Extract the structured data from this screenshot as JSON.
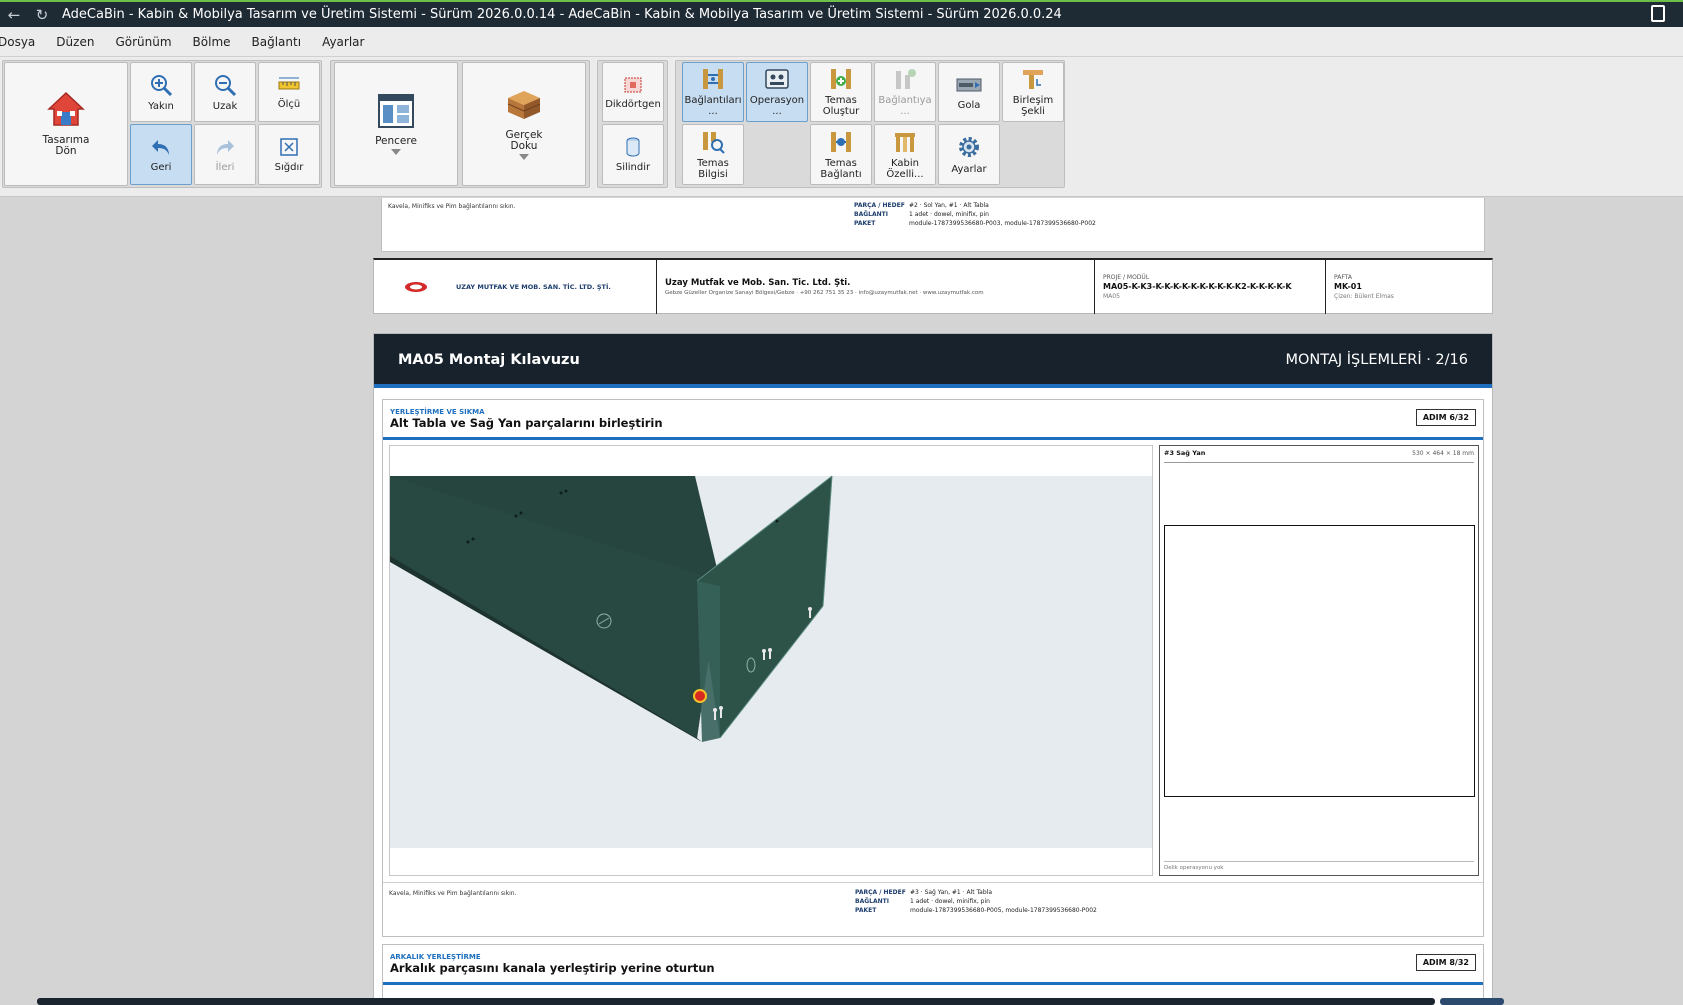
{
  "window": {
    "title": "AdeCaBin - Kabin & Mobilya Tasarım ve Üretim Sistemi - Sürüm 2026.0.0.14 - AdeCaBin - Kabin & Mobilya Tasarım ve Üretim Sistemi - Sürüm 2026.0.0.24"
  },
  "menu": [
    "Dosya",
    "Düzen",
    "Görünüm",
    "Bölme",
    "Bağlantı",
    "Ayarlar"
  ],
  "ribbon": {
    "home": "Tasarıma Dön",
    "zoom_in": "Yakın",
    "zoom_out": "Uzak",
    "measure": "Ölçü",
    "back": "Geri",
    "forward": "İleri",
    "fit": "Sığdır",
    "window": "Pencere",
    "texture": "Gerçek Doku",
    "rectangle": "Dikdörtgen",
    "cylinder": "Silindir",
    "connections": "Bağlantıları ...",
    "operation": "Operasyon ...",
    "create_contact": "Temas Oluştur",
    "connection_disabled": "Bağlantıya ...",
    "gola": "Gola",
    "join_shape": "Birleşim Şekli",
    "contact_info": "Temas Bilgisi",
    "contact_connection": "Temas Bağlantı",
    "cabin_props": "Kabin Özelli...",
    "settings": "Ayarlar"
  },
  "prev_step": {
    "note": "Kavela, Minifiks ve Pim bağlantılarını sıkın.",
    "part_label": "PARÇA / HEDEF",
    "part_value": "#2 · Sol Yan, #1 · Alt Tabla",
    "conn_label": "BAĞLANTI",
    "conn_value": "1 adet · dowel, minifix, pin",
    "pkg_label": "PAKET",
    "pkg_value": "module-1787399536680-P003, module-1787399536680-P002"
  },
  "footer": {
    "company_short": "UZAY MUTFAK VE MOB. SAN. TİC. LTD. ŞTİ.",
    "company": "Uzay Mutfak ve Mob. San. Tic. Ltd. Şti.",
    "address": "Gebze Güzeller Organize Sanayi Bölgesi/Gebze · +90 262 751 35 23 · info@uzaymutfak.net · www.uzaymutfak.com",
    "project_label": "PROJE / MODÜL",
    "project_value": "MA05-K-K3-K-K-K-K-K-K-K-K-K-K2-K-K-K-K-K",
    "project_sub": "MA05",
    "sheet_label": "PAFTA",
    "sheet_value": "MK-01",
    "drawn_by": "Çizen: Bülent Elmas"
  },
  "page": {
    "title": "MA05 Montaj Kılavuzu",
    "section": "MONTAJ İŞLEMLERİ · 2/16"
  },
  "step": {
    "kicker": "YERLEŞTİRME VE SIKMA",
    "title": "Alt Tabla ve Sağ Yan parçalarını birleştirin",
    "badge": "ADIM 6/32",
    "part_name": "#3 Sağ Yan",
    "part_dims": "530 × 464 × 18 mm",
    "hole_note": "Delik operasyonu yok",
    "note": "Kavela, Minifiks ve Pim bağlantılarını sıkın.",
    "part_label": "PARÇA / HEDEF",
    "part_value": "#3 · Sağ Yan, #1 · Alt Tabla",
    "conn_label": "BAĞLANTI",
    "conn_value": "1 adet · dowel, minifix, pin",
    "pkg_label": "PAKET",
    "pkg_value": "module-1787399536680-P005, module-1787399536680-P002"
  },
  "next_step": {
    "kicker": "ARKALIK YERLEŞTİRME",
    "title": "Arkalık parçasını kanala yerleştirip yerine oturtun",
    "badge": "ADIM 8/32"
  },
  "colors": {
    "titlebar": "#1e2a34",
    "accent": "#1e6fbf",
    "page_header": "#18222c",
    "panel": "#264a41"
  }
}
